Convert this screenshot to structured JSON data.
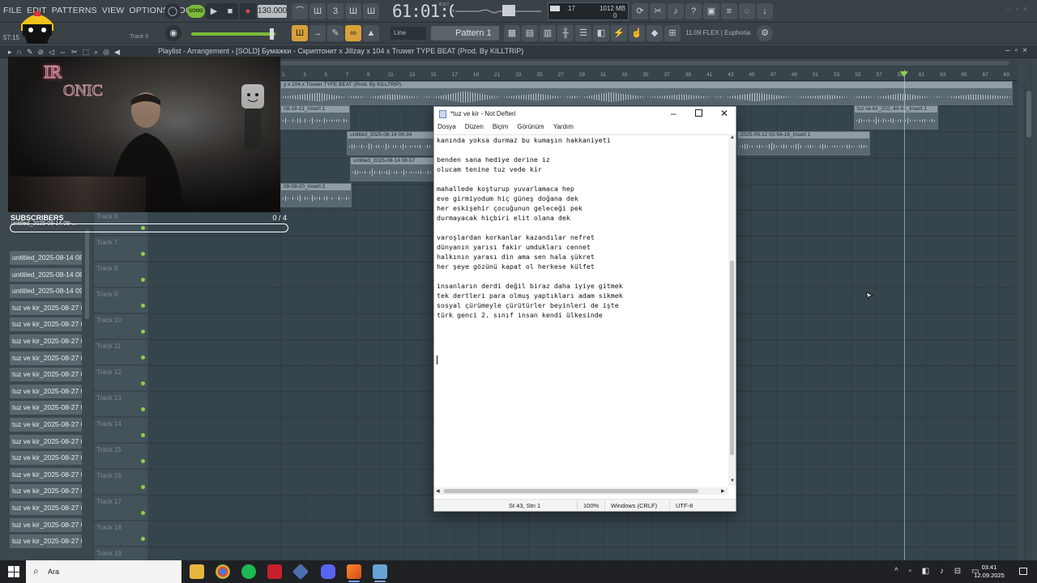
{
  "fl_menu": [
    "FILE",
    "EDIT",
    "PATTERNS",
    "VIEW",
    "OPTIONS",
    "TOOLS",
    "HELP"
  ],
  "fl_toolbar": {
    "song_label": "SONG",
    "tempo": "130.000",
    "time": "61:01:00",
    "time_format": "B:S:T",
    "memory": "1012 MB",
    "cpu": "17",
    "poly": "0",
    "snap": "Line",
    "pattern": "Pattern 1",
    "plugin_info": "11:09  FLEX | Euphoria",
    "song_position": "57:15",
    "hint_track": "Track 9"
  },
  "playlist": {
    "title": "Playlist - Arrangement",
    "project": "[SOLD] Бумажки - Скриптонит x Jillzay x 104 x Truwer TYPE BEAT (Prod. By KILLTRIP)",
    "bars": [
      "1",
      "3",
      "5",
      "7",
      "9",
      "11",
      "13",
      "15",
      "17",
      "19",
      "21",
      "23",
      "25",
      "27",
      "29",
      "31",
      "33",
      "35",
      "37",
      "39",
      "41",
      "43",
      "45",
      "47",
      "49",
      "51",
      "53",
      "55",
      "57",
      "59",
      "61",
      "63",
      "65",
      "67",
      "69"
    ],
    "main_clip": "y x 104 x Truwer TYPE BEAT (Prod. By KILLTRIP)",
    "clips": [
      {
        "label": "08-18-21_Insert 1"
      },
      {
        "label": "untitled_2025-08-14 08-34"
      },
      {
        "label": "untitled_2025-08-14 08-57"
      },
      {
        "label": "09-09-20_Insert 2"
      },
      {
        "label": "2025-09-12 02-54-16_Insert 1"
      },
      {
        "label": "tuz ve kir_202..40-41_Insert 1"
      }
    ],
    "tracks": [
      "Track 6",
      "Track 7",
      "Track 8",
      "Track 9",
      "Track 10",
      "Track 11",
      "Track 12",
      "Track 13",
      "Track 14",
      "Track 15",
      "Track 16",
      "Track 17",
      "Track 18",
      "Track 19"
    ],
    "picker": [
      "untitled_2025-08-14 08-...",
      "untitled_2025-08-14 08-...",
      "untitled_2025-08-14 09-...",
      "tuz ve kir_2025-08-27 08...",
      "tuz ve kir_2025-08-27 08...",
      "tuz ve kir_2025-08-27 08...",
      "tuz ve kir_2025-08-27 08...",
      "tuz ve kir_2025-08-27 08...",
      "tuz ve kir_2025-08-27 08...",
      "tuz ve kir_2025-08-27 08...",
      "tuz ve kir_2025-08-27 08...",
      "tuz ve kir_2025-08-27 08...",
      "tuz ve kir_2025-08-27 08...",
      "tuz ve kir_2025-08-27 08...",
      "tuz ve kir_2025-08-27 08...",
      "tuz ve kir_2025-08-27 08...",
      "tuz ve kir_2025-08-27 08...",
      "tuz ve kir_2025-08-27 08..."
    ],
    "picker_first": "untitled_2025-08-14 08-..."
  },
  "overlay": {
    "neon_text": "IRONIC",
    "subscribers_label": "SUBSCRIBERS",
    "subscribers_count": "0 / 4"
  },
  "notepad": {
    "title": "*tuz ve kir - Not Defteri",
    "menu": [
      "Dosya",
      "Düzen",
      "Biçim",
      "Görünüm",
      "Yardım"
    ],
    "lines": [
      "kanında yoksa durmaz bu kumaşın hakkaniyeti",
      "",
      "benden sana hediye derine iz",
      "olucam tenine tuz vede kir",
      "",
      "mahallede koşturup yuvarlamaca hep",
      "eve girmiyodum hiç güneş doğana dek",
      "her eskişehir çocuğunun geleceği pek",
      "durmayacak hiçbiri elit olana dek",
      "",
      "varoşlardan korkanlar kazandılar nefret",
      "dünyanın yarısı fakir umdukları cennet",
      "halkının yarası din ama sen hala şükret",
      "her şeye gözünü kapat ol herkese külfet",
      "",
      "insanların derdi değil biraz daha iyiye gitmek",
      "tek dertleri para olmuş yaptıkları adam sikmek",
      "sosyal çürümeyle çürütürler beyinleri de işte",
      "türk genci 2. sınıf insan kendi ülkesinde"
    ],
    "status": {
      "position": "St 43, Stn 1",
      "zoom": "100%",
      "line_ending": "Windows (CRLF)",
      "encoding": "UTF-8"
    }
  },
  "taskbar": {
    "search_placeholder": "Ara",
    "time": "03:41",
    "date": "12.09.2025"
  }
}
